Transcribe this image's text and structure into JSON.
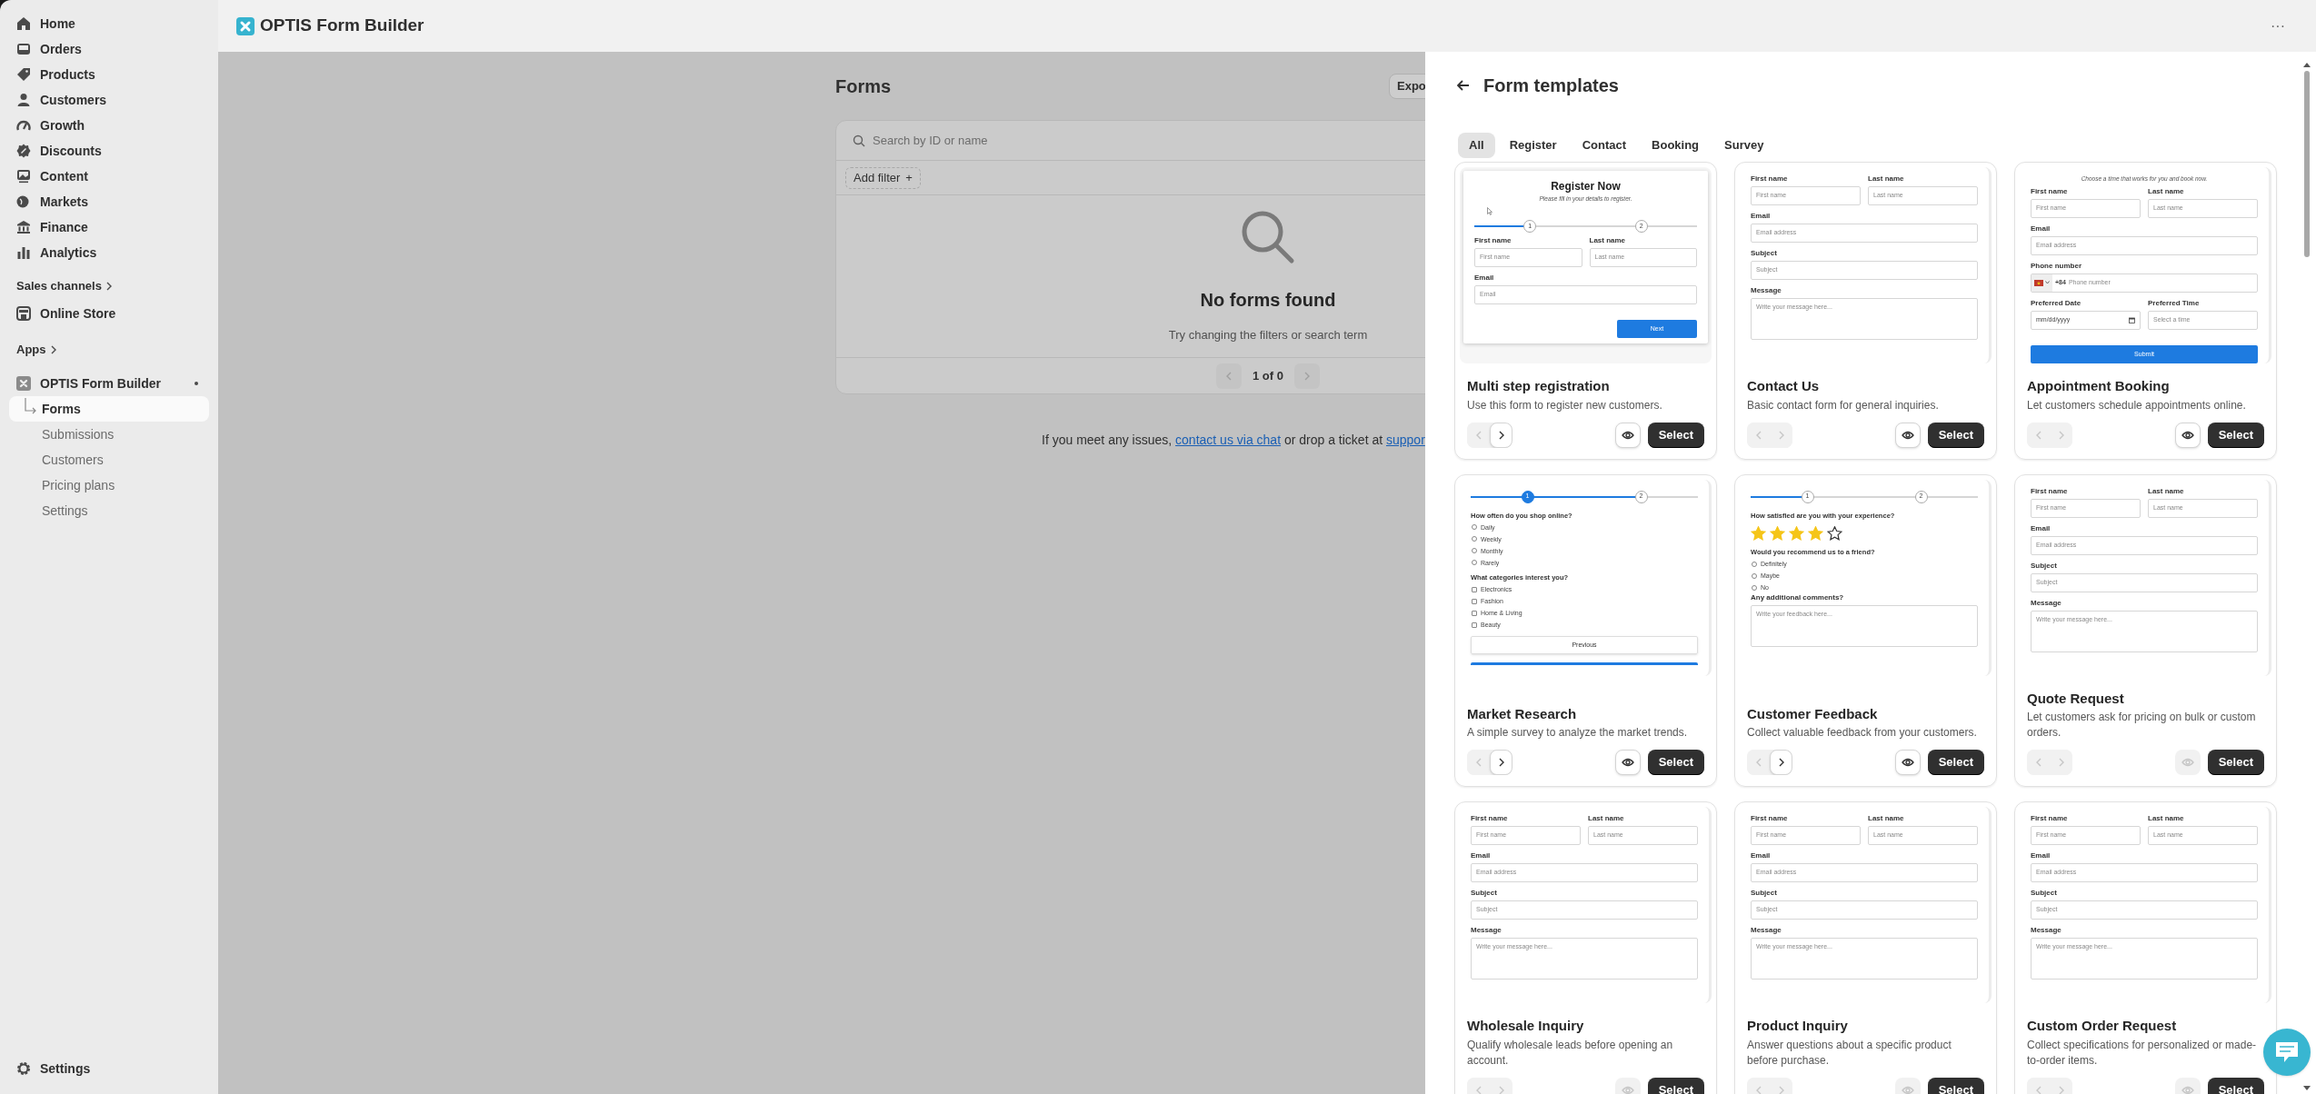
{
  "sidebar": {
    "nav": [
      {
        "label": "Home"
      },
      {
        "label": "Orders"
      },
      {
        "label": "Products"
      },
      {
        "label": "Customers"
      },
      {
        "label": "Growth"
      },
      {
        "label": "Discounts"
      },
      {
        "label": "Content"
      },
      {
        "label": "Markets"
      },
      {
        "label": "Finance"
      },
      {
        "label": "Analytics"
      }
    ],
    "sales_channels": {
      "label": "Sales channels",
      "items": [
        {
          "label": "Online Store"
        }
      ]
    },
    "apps": {
      "label": "Apps",
      "app": {
        "name": "OPTIS Form Builder",
        "items": [
          {
            "label": "Forms",
            "selected": true
          },
          {
            "label": "Submissions",
            "selected": false
          },
          {
            "label": "Customers",
            "selected": false
          },
          {
            "label": "Pricing plans",
            "selected": false
          },
          {
            "label": "Settings",
            "selected": false
          }
        ]
      }
    },
    "settings": "Settings"
  },
  "top_bar": {
    "title": "OPTIS Form Builder",
    "menu": "···"
  },
  "page": {
    "title": "Forms",
    "export_button": "Expo",
    "search": {
      "placeholder": "Search by ID or name"
    },
    "add_filter": "Add filter",
    "add_filter_icon": "+",
    "empty": {
      "title": "No forms found",
      "text": "Try changing the filters or search term"
    },
    "pagination": "1 of 0",
    "footer": {
      "before": "If you meet any issues, ",
      "link": "contact us via chat",
      "middle": " or drop a ticket at ",
      "link_2": "suppor"
    }
  },
  "panel": {
    "title": "Form templates",
    "tabs": [
      {
        "label": "All",
        "selected": true
      },
      {
        "label": "Register",
        "selected": false
      },
      {
        "label": "Contact",
        "selected": false
      },
      {
        "label": "Booking",
        "selected": false
      },
      {
        "label": "Survey",
        "selected": false
      }
    ],
    "cards": [
      {
        "title": "Multi step registration",
        "description": "Use this form to register new customers.",
        "prev_disabled": true,
        "next_disabled": false,
        "preview_disabled": false,
        "select": "Select",
        "framed": true,
        "preview": [
          {
            "kind": "heading",
            "text": "Register Now"
          },
          {
            "kind": "subtitle",
            "text": "Please fill in your details to register."
          },
          {
            "kind": "cursor"
          },
          {
            "kind": "stepper",
            "level": 0.25,
            "steps": [
              {
                "label": "1",
                "filled": false
              },
              {
                "label": "2",
                "filled": false
              }
            ]
          },
          {
            "kind": "row",
            "fields": [
              {
                "label": "First name",
                "placeholder": "First name"
              },
              {
                "label": "Last name",
                "placeholder": "Last name"
              }
            ]
          },
          {
            "kind": "field",
            "label": "Email",
            "placeholder": "Email"
          },
          {
            "kind": "button",
            "text": "Next",
            "full_width": false
          }
        ]
      },
      {
        "title": "Contact Us",
        "description": "Basic contact form for general inquiries.",
        "prev_disabled": true,
        "next_disabled": true,
        "preview_disabled": false,
        "select": "Select",
        "framed": false,
        "preview": [
          {
            "kind": "row",
            "fields": [
              {
                "label": "First name",
                "placeholder": "First name"
              },
              {
                "label": "Last name",
                "placeholder": "Last name"
              }
            ]
          },
          {
            "kind": "field",
            "label": "Email",
            "placeholder": "Email address"
          },
          {
            "kind": "field",
            "label": "Subject",
            "placeholder": "Subject"
          },
          {
            "kind": "textarea",
            "label": "Message",
            "placeholder": "Write your message here..."
          }
        ]
      },
      {
        "title": "Appointment Booking",
        "description": "Let customers schedule appointments online.",
        "prev_disabled": true,
        "next_disabled": true,
        "preview_disabled": false,
        "select": "Select",
        "framed": false,
        "preview": [
          {
            "kind": "subtitle",
            "text": "Choose a time that works for you and book now."
          },
          {
            "kind": "row",
            "fields": [
              {
                "label": "First name",
                "placeholder": "First name"
              },
              {
                "label": "Last name",
                "placeholder": "Last name"
              }
            ]
          },
          {
            "kind": "field",
            "label": "Email",
            "placeholder": "Email address"
          },
          {
            "kind": "phone",
            "label": "Phone number",
            "code": "+84",
            "placeholder": "Phone number"
          },
          {
            "kind": "date-time-row",
            "date": {
              "label": "Preferred Date",
              "placeholder": "mm/dd/yyyy"
            },
            "time": {
              "label": "Preferred Time",
              "placeholder": "Select a time"
            }
          },
          {
            "kind": "button",
            "text": "Submit",
            "full_width": true
          }
        ]
      },
      {
        "title": "Market Research",
        "description": "A simple survey to analyze the market trends.",
        "prev_disabled": true,
        "next_disabled": false,
        "preview_disabled": false,
        "select": "Select",
        "framed": false,
        "preview": [
          {
            "kind": "stepper",
            "level": 0.75,
            "steps": [
              {
                "label": "1",
                "filled": true
              },
              {
                "label": "2",
                "filled": false
              }
            ]
          },
          {
            "kind": "question",
            "text": "How often do you shop online?"
          },
          {
            "kind": "radios",
            "options": [
              "Daily",
              "Weekly",
              "Monthly",
              "Rarely"
            ]
          },
          {
            "kind": "question",
            "text": "What categories interest you?"
          },
          {
            "kind": "checkboxes",
            "options": [
              "Electronics",
              "Fashion",
              "Home & Living",
              "Beauty"
            ]
          },
          {
            "kind": "outline-button",
            "text": "Previous"
          },
          {
            "kind": "button-edge"
          }
        ]
      },
      {
        "title": "Customer Feedback",
        "description": "Collect valuable feedback from your customers.",
        "prev_disabled": true,
        "next_disabled": false,
        "preview_disabled": false,
        "select": "Select",
        "framed": false,
        "preview": [
          {
            "kind": "stepper",
            "level": 0.25,
            "steps": [
              {
                "label": "1",
                "filled": false
              },
              {
                "label": "2",
                "filled": false
              }
            ]
          },
          {
            "kind": "question",
            "text": "How satisfied are you with your experience?"
          },
          {
            "kind": "rating",
            "stars": 4
          },
          {
            "kind": "question",
            "text": "Would you recommend us to a friend?"
          },
          {
            "kind": "radios",
            "options": [
              "Definitely",
              "Maybe",
              "No"
            ]
          },
          {
            "kind": "textarea",
            "label": "Any additional comments?",
            "placeholder": "Write your feedback here..."
          }
        ]
      },
      {
        "title": "Quote Request",
        "description": "Let customers ask for pricing on bulk or custom orders.",
        "prev_disabled": true,
        "next_disabled": true,
        "preview_disabled": true,
        "select": "Select",
        "framed": false,
        "preview": [
          {
            "kind": "row",
            "fields": [
              {
                "label": "First name",
                "placeholder": "First name"
              },
              {
                "label": "Last name",
                "placeholder": "Last name"
              }
            ]
          },
          {
            "kind": "field",
            "label": "Email",
            "placeholder": "Email address"
          },
          {
            "kind": "field",
            "label": "Subject",
            "placeholder": "Subject"
          },
          {
            "kind": "textarea",
            "label": "Message",
            "placeholder": "Write your message here..."
          }
        ]
      },
      {
        "title": "Wholesale Inquiry",
        "description": "Qualify wholesale leads before opening an account.",
        "prev_disabled": true,
        "next_disabled": true,
        "preview_disabled": true,
        "select": "Select",
        "framed": false,
        "preview": [
          {
            "kind": "row",
            "fields": [
              {
                "label": "First name",
                "placeholder": "First name"
              },
              {
                "label": "Last name",
                "placeholder": "Last name"
              }
            ]
          },
          {
            "kind": "field",
            "label": "Email",
            "placeholder": "Email address"
          },
          {
            "kind": "field",
            "label": "Subject",
            "placeholder": "Subject"
          },
          {
            "kind": "textarea",
            "label": "Message",
            "placeholder": "Write your message here..."
          }
        ]
      },
      {
        "title": "Product Inquiry",
        "description": "Answer questions about a specific product before purchase.",
        "prev_disabled": true,
        "next_disabled": true,
        "preview_disabled": true,
        "select": "Select",
        "framed": false,
        "preview": [
          {
            "kind": "row",
            "fields": [
              {
                "label": "First name",
                "placeholder": "First name"
              },
              {
                "label": "Last name",
                "placeholder": "Last name"
              }
            ]
          },
          {
            "kind": "field",
            "label": "Email",
            "placeholder": "Email address"
          },
          {
            "kind": "field",
            "label": "Subject",
            "placeholder": "Subject"
          },
          {
            "kind": "textarea",
            "label": "Message",
            "placeholder": "Write your message here..."
          }
        ]
      },
      {
        "title": "Custom Order Request",
        "description": "Collect specifications for personalized or made-to-order items.",
        "prev_disabled": true,
        "next_disabled": true,
        "preview_disabled": true,
        "select": "Select",
        "framed": false,
        "preview": [
          {
            "kind": "row",
            "fields": [
              {
                "label": "First name",
                "placeholder": "First name"
              },
              {
                "label": "Last name",
                "placeholder": "Last name"
              }
            ]
          },
          {
            "kind": "field",
            "label": "Email",
            "placeholder": "Email address"
          },
          {
            "kind": "field",
            "label": "Subject",
            "placeholder": "Subject"
          },
          {
            "kind": "textarea",
            "label": "Message",
            "placeholder": "Write your message here..."
          }
        ]
      }
    ]
  }
}
